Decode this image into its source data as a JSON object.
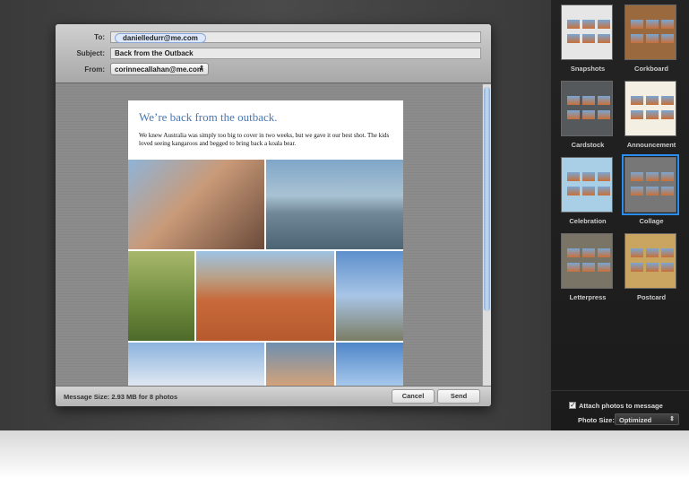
{
  "compose": {
    "to_label": "To:",
    "to_value": "danielledurr@me.com",
    "subject_label": "Subject:",
    "subject_value": "Back from the Outback",
    "from_label": "From:",
    "from_value": "corinnecallahan@me.com"
  },
  "message": {
    "heading": "We’re back from the outback.",
    "body": "We knew Australia was simply too big to cover in two weeks, but we gave it our best shot. The kids loved seeing kangaroos and begged to bring back a koala bear."
  },
  "footer": {
    "message_size": "Message Size: 2.93 MB for 8 photos",
    "cancel": "Cancel",
    "send": "Send"
  },
  "templates": [
    {
      "label": "Snapshots",
      "color": "#e6e6e6"
    },
    {
      "label": "Corkboard",
      "color": "#9a6a3e"
    },
    {
      "label": "Cardstock",
      "color": "#55595c"
    },
    {
      "label": "Announcement",
      "color": "#f3efe2"
    },
    {
      "label": "Celebration",
      "color": "#a9cfe6"
    },
    {
      "label": "Collage",
      "color": "#777777"
    },
    {
      "label": "Letterpress",
      "color": "#7a7466"
    },
    {
      "label": "Postcard",
      "color": "#c9a561"
    }
  ],
  "selected_template": "Collage",
  "options": {
    "attach_label": "Attach photos to message",
    "attach_checked": true,
    "photo_size_label": "Photo Size:",
    "photo_size_value": "Optimized"
  }
}
